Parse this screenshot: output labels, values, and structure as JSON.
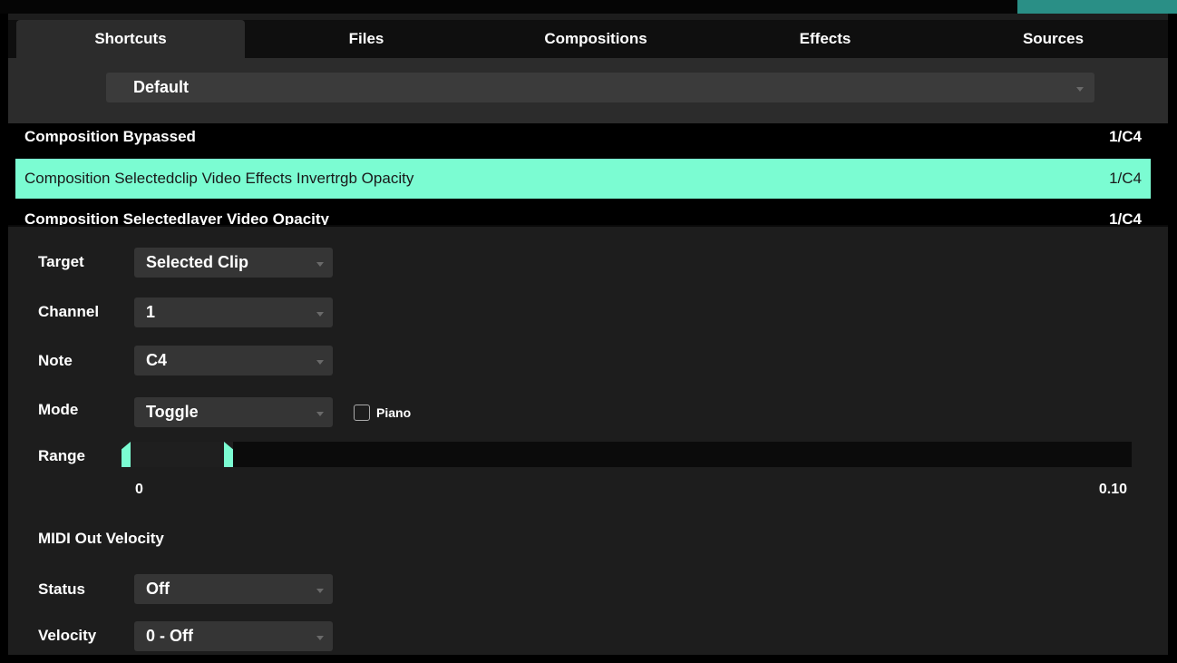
{
  "tabs": [
    "Shortcuts",
    "Files",
    "Compositions",
    "Effects",
    "Sources"
  ],
  "active_tab": "Shortcuts",
  "preset": {
    "value": "Default"
  },
  "shortcuts": [
    {
      "name": "Composition Bypassed",
      "key": "1/C4"
    },
    {
      "name": "Composition Selectedclip Video Effects Invertrgb Opacity",
      "key": "1/C4"
    },
    {
      "name": "Composition Selectedlayer Video Opacity",
      "key": "1/C4"
    }
  ],
  "selected_shortcut": 1,
  "settings": {
    "target": {
      "label": "Target",
      "value": "Selected Clip"
    },
    "channel": {
      "label": "Channel",
      "value": "1"
    },
    "note": {
      "label": "Note",
      "value": "C4"
    },
    "mode": {
      "label": "Mode",
      "value": "Toggle"
    },
    "piano": {
      "label": "Piano",
      "checked": false
    },
    "range": {
      "label": "Range",
      "min_label": "0",
      "max_label": "0.10",
      "low_fraction": 0.0,
      "high_fraction": 0.11
    }
  },
  "midi_out": {
    "heading": "MIDI Out Velocity",
    "status": {
      "label": "Status",
      "value": "Off"
    },
    "velocity": {
      "label": "Velocity",
      "value": "0 - Off"
    }
  },
  "colors": {
    "accent": "#7bfcd2",
    "panel": "#1d1d1d",
    "tabbar": "#0f0f0f"
  }
}
